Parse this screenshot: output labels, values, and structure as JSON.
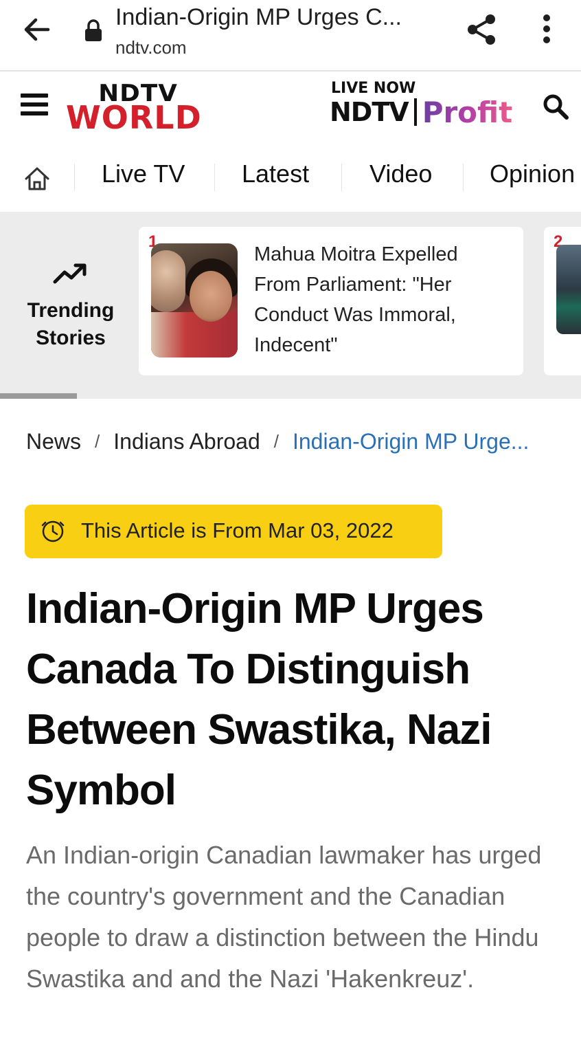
{
  "browser": {
    "page_title": "Indian-Origin MP Urges C...",
    "url": "ndtv.com"
  },
  "header": {
    "logo_top": "NDTV",
    "logo_bottom": "WORLD",
    "live_now": "LIVE NOW",
    "partner_ndtv": "NDTV",
    "partner_profit": "Profit"
  },
  "nav": {
    "items": [
      {
        "label": "Live TV"
      },
      {
        "label": "Latest"
      },
      {
        "label": "Video"
      },
      {
        "label": "Opinion"
      }
    ]
  },
  "trending": {
    "label": "Trending Stories",
    "stories": [
      {
        "rank": "1",
        "headline": "Mahua Moitra Expelled From Parliament: \"Her Conduct Was Immoral, Indecent\""
      },
      {
        "rank": "2",
        "headline": ""
      }
    ]
  },
  "breadcrumb": {
    "items": [
      "News",
      "Indians Abroad"
    ],
    "current": "Indian-Origin MP Urge..."
  },
  "article": {
    "archive_notice": "This Article is From Mar 03, 2022",
    "title": "Indian-Origin MP Urges Canada To Distinguish Between Swastika, Nazi Symbol",
    "summary": "An Indian-origin Canadian lawmaker has urged the country's government and the Canadian people to draw a distinction between the Hindu Swastika and and the Nazi 'Hakenkreuz'."
  },
  "colors": {
    "brand_red": "#d3202a",
    "badge_yellow": "#f9cf13",
    "link_blue": "#2a70b8"
  },
  "icons": [
    "back-arrow-icon",
    "lock-icon",
    "share-icon",
    "more-vert-icon",
    "menu-icon",
    "search-icon",
    "home-icon",
    "trending-up-icon",
    "clock-icon"
  ]
}
